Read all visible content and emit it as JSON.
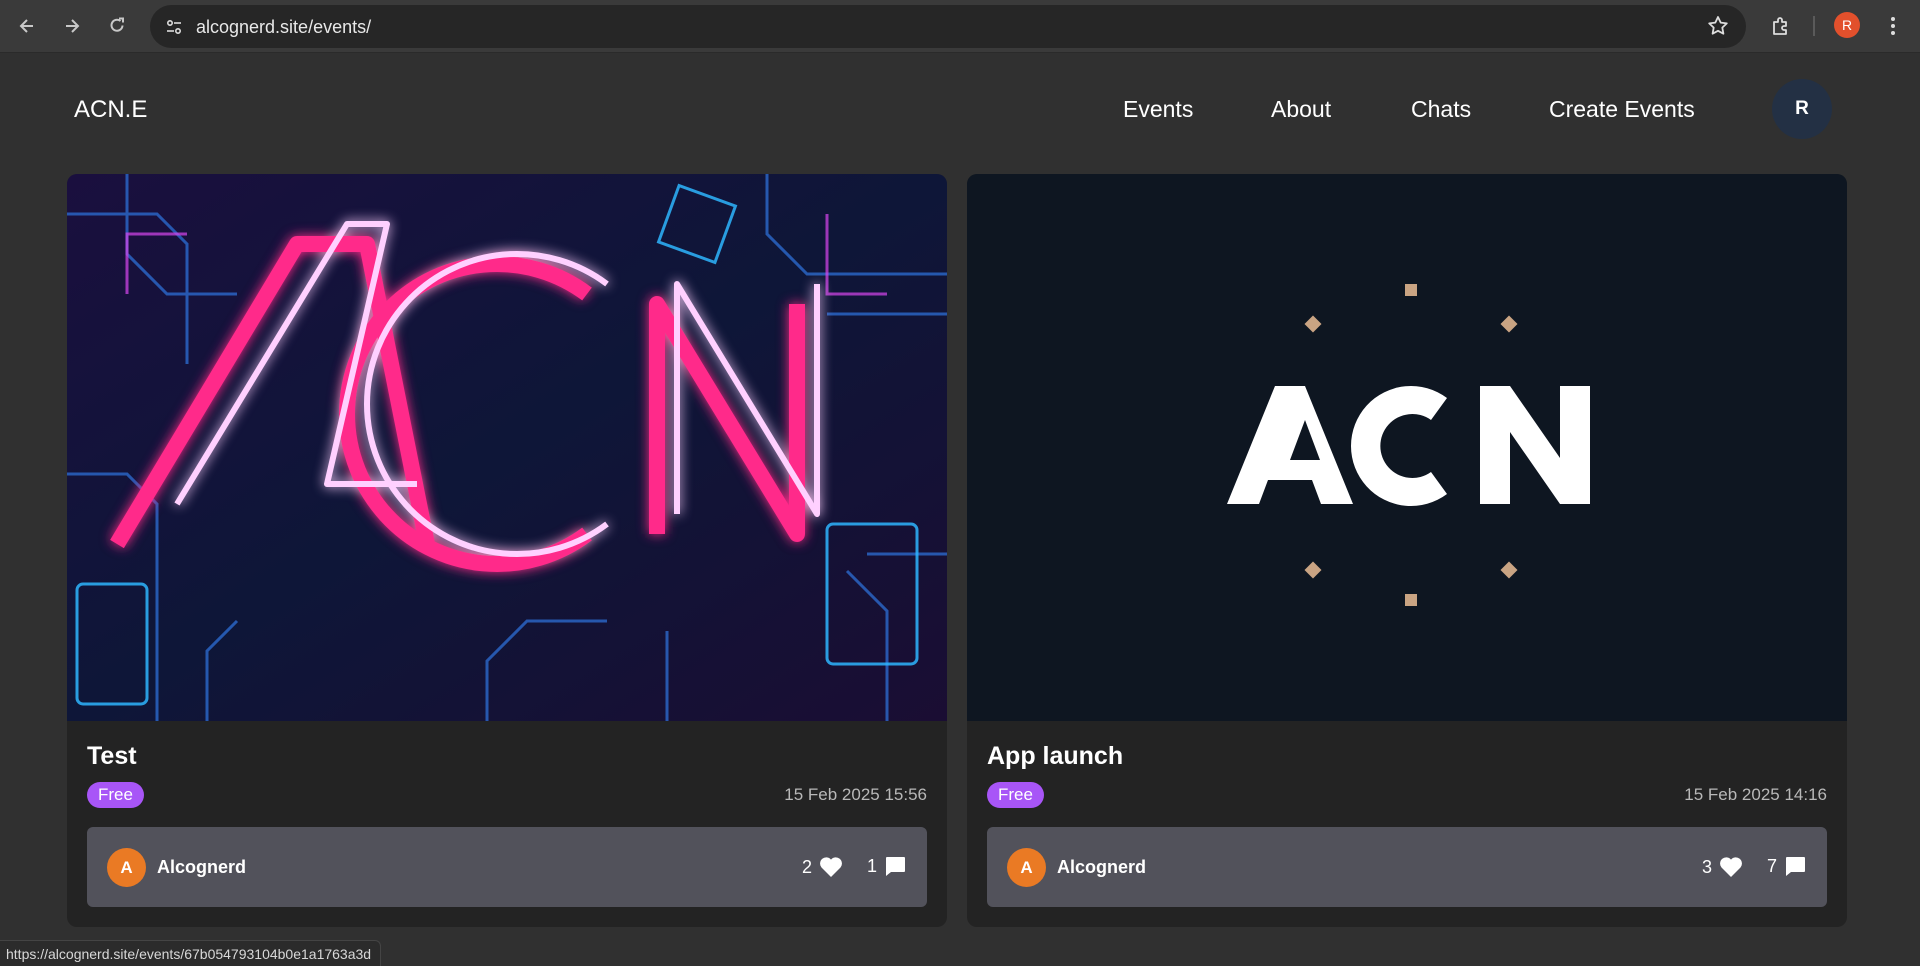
{
  "browser": {
    "url": "alcognerd.site/events/",
    "profile_initial": "R",
    "status_url": "https://alcognerd.site/events/67b054793104b0e1a1763a3d"
  },
  "site": {
    "logo": "ACN.E",
    "nav": [
      "Events",
      "About",
      "Chats",
      "Create Events"
    ],
    "user_initial": "R"
  },
  "events": [
    {
      "title": "Test",
      "price": "Free",
      "date": "15 Feb 2025 15:56",
      "author_initial": "A",
      "author": "Alcognerd",
      "likes": "2",
      "comments": "1",
      "image_text": "ACN",
      "image_style": "neon"
    },
    {
      "title": "App launch",
      "price": "Free",
      "date": "15 Feb 2025 14:16",
      "author_initial": "A",
      "author": "Alcognerd",
      "likes": "3",
      "comments": "7",
      "image_text": "ACN",
      "image_style": "minimal"
    }
  ],
  "colors": {
    "page_bg": "#303030",
    "card_bg": "#232323",
    "badge": "#a855f7",
    "author_avatar": "#ea7a24",
    "author_bar": "#52525b"
  }
}
